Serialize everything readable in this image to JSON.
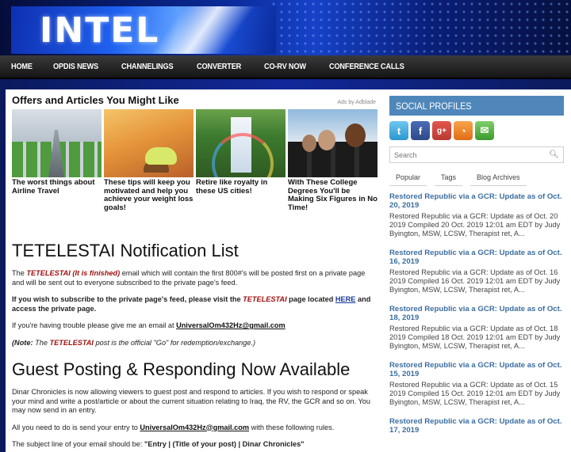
{
  "header": {
    "logo_text": "INTEL"
  },
  "nav": {
    "items": [
      "HOME",
      "OPDIS NEWS",
      "CHANNELINGS",
      "CONVERTER",
      "CO-RV NOW",
      "CONFERENCE CALLS"
    ]
  },
  "offers": {
    "title": "Offers and Articles You Might Like",
    "ads_by": "Ads by Adblade",
    "items": [
      {
        "caption": "The worst things about Airline Travel"
      },
      {
        "caption": "These tips will keep you motivated and help you achieve your weight loss goals!"
      },
      {
        "caption": "Retire like royalty in these US cities!"
      },
      {
        "caption": "With These College Degrees You'll be Making Six Figures in No Time!"
      }
    ]
  },
  "article1": {
    "title": "TETELESTAI Notification List",
    "p1_pre": "The ",
    "p1_red": "TETELESTAI (It is finished)",
    "p1_post": " email which will contain the first 800#'s will be posted first on a private page and will be sent out to everyone subscribed to the private page's feed.",
    "p2_pre": "If you wish to subscribe to the private page's feed, please visit the ",
    "p2_red": "TETELESTAI",
    "p2_mid": " page located ",
    "p2_link": "HERE",
    "p2_post": " and access the private page.",
    "p3_pre": "If you're having trouble please give me an email at ",
    "p3_email": "UniversalOm432Hz@gmail.com",
    "p4_pre": "(Note: ",
    "p4_mid1": "The ",
    "p4_red": "TETELESTAI",
    "p4_post": " post is the official \"Go\" for redemption/exchange.)"
  },
  "article2": {
    "title": "Guest Posting & Responding Now Available",
    "p1": "Dinar Chronicles is now allowing viewers to guest post and respond to articles. If you wish to respond or speak your mind and write a post/article or about the current situation relating to Iraq, the RV, the GCR and so on. You may now send in an entry.",
    "p2_pre": "All you need to do is send your entry to ",
    "p2_email": "UniversalOm432Hz@gmail.com",
    "p2_post": " with these following rules.",
    "p3_pre": "The subject line of your email should be: ",
    "p3_bold": "\"Entry | (Title of your post) | Dinar Chronicles\""
  },
  "sidebar": {
    "social_title": "SOCIAL PROFILES",
    "social_icons": [
      "twitter-icon",
      "facebook-icon",
      "google-plus-icon",
      "rss-icon",
      "email-icon"
    ],
    "search_placeholder": "Search",
    "tabs": [
      "Popular",
      "Tags",
      "Blog Archives"
    ],
    "posts": [
      {
        "title": "Restored Republic via a GCR: Update as of Oct. 20, 2019",
        "snippet": "Restored Republic via a GCR: Update as of Oct. 20 2019 Compiled 20 Oct. 2019 12:01 am EDT by Judy Byington, MSW, LCSW, Therapist ret, A..."
      },
      {
        "title": "Restored Republic via a GCR: Update as of Oct. 16, 2019",
        "snippet": "Restored Republic via a GCR: Update as of Oct. 16 2019 Compiled 16 Oct. 2019 12:01 am EDT by Judy Byington, MSW, LCSW, Therapist ret, A..."
      },
      {
        "title": "Restored Republic via a GCR: Update as of Oct. 18, 2019",
        "snippet": "Restored Republic via a GCR: Update as of Oct. 18 2019 Compiled 18 Oct. 2019 12:01 am EDT by Judy Byington, MSW, LCSW, Therapist ret, A..."
      },
      {
        "title": "Restored Republic via a GCR: Update as of Oct. 15, 2019",
        "snippet": "Restored Republic via a GCR: Update as of Oct. 15 2019 Compiled 15 Oct. 2019 12:01 am EDT by Judy Byington, MSW, LCSW, Therapist ret, A..."
      },
      {
        "title": "Restored Republic via a GCR: Update as of Oct. 17, 2019",
        "snippet": ""
      }
    ]
  },
  "colors": {
    "accent": "#4f87ba",
    "link": "#3b6ea0",
    "red": "#9a1111"
  }
}
